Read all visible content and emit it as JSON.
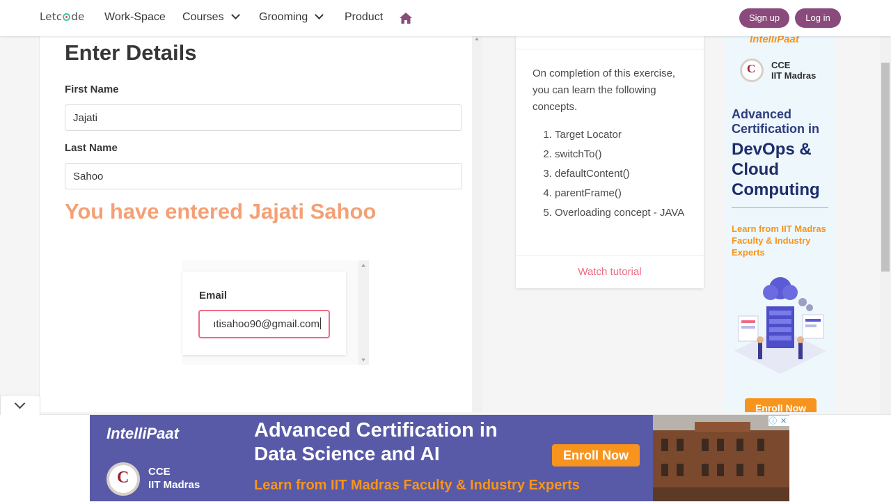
{
  "nav": {
    "logo_pre": "Let",
    "logo_post": "de",
    "items": [
      {
        "label": "Work-Space"
      },
      {
        "label": "Courses"
      },
      {
        "label": "Grooming"
      },
      {
        "label": "Product"
      }
    ],
    "home_icon": "home-icon",
    "signup_label": "Sign up",
    "login_label": "Log in",
    "accent_color": "#8a4b7c"
  },
  "form": {
    "title": "Enter Details",
    "first_name_label": "First Name",
    "first_name_value": "Jajati",
    "last_name_label": "Last Name",
    "last_name_value": "Sahoo",
    "result_text": "You have entered Jajati Sahoo",
    "result_color": "#f4a075"
  },
  "inner_frame": {
    "email_label": "Email",
    "email_visible_value": "ıtisahoo90@gmail.com"
  },
  "info_card": {
    "intro": "On completion of this exercise, you can learn the following concepts.",
    "concepts": [
      "Target Locator",
      "switchTo()",
      "defaultContent()",
      "parentFrame()",
      "Overloading concept - JAVA"
    ],
    "watch_label": "Watch tutorial",
    "watch_color": "#f06b83"
  },
  "side_ad": {
    "brand": "IntelliPaat",
    "cce_line1": "CCE",
    "cce_line2": "IIT Madras",
    "headline1": "Advanced Certification in",
    "headline2": "DevOps & Cloud Computing",
    "subline": "Learn from IIT Madras Faculty & Industry Experts",
    "enroll_label": "Enroll Now"
  },
  "bottom_ad": {
    "brand": "IntelliPaat",
    "cce_line1": "CCE",
    "cce_line2": "IIT Madras",
    "headline1": "Advanced Certification in",
    "headline2": "Data Science and AI",
    "subline": "Learn from IIT Madras Faculty & Industry Experts",
    "enroll_label": "Enroll Now",
    "adchoices_icon": "adchoices-icon",
    "close_icon": "close-icon"
  },
  "collapse_icon": "chevron-down-icon"
}
